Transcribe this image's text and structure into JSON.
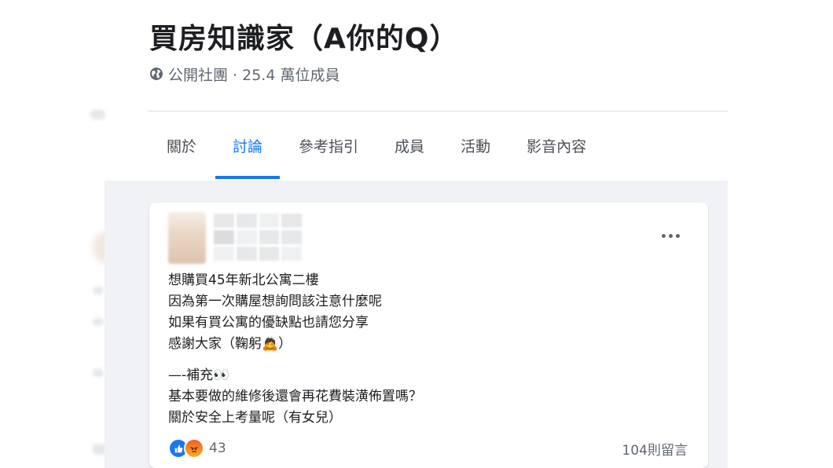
{
  "group": {
    "title": "買房知識家（A你的Q）",
    "meta": "公開社團 · 25.4 萬位成員"
  },
  "icons": {
    "globe": "globe-icon",
    "more": "more-options-icon",
    "like": "like-reaction-icon",
    "angry": "angry-reaction-icon"
  },
  "tabs": [
    {
      "label": "關於",
      "active": false
    },
    {
      "label": "討論",
      "active": true
    },
    {
      "label": "參考指引",
      "active": false
    },
    {
      "label": "成員",
      "active": false
    },
    {
      "label": "活動",
      "active": false
    },
    {
      "label": "影音內容",
      "active": false
    }
  ],
  "post": {
    "lines": [
      "想購買45年新北公寓二樓",
      "因為第一次購屋想詢問該注意什麼呢",
      "如果有買公寓的優缺點也請您分享",
      "感謝大家（鞠躬🙇）"
    ],
    "supplement": [
      "—-補充👀",
      "基本要做的維修後還會再花費裝潢佈置嗎？",
      "關於安全上考量呢（有女兒）"
    ],
    "reaction_count": "43",
    "comment_count": "104則留言"
  },
  "colors": {
    "accent": "#1877f2",
    "feed_background": "#f0f2f5",
    "muted_text": "#606770"
  }
}
